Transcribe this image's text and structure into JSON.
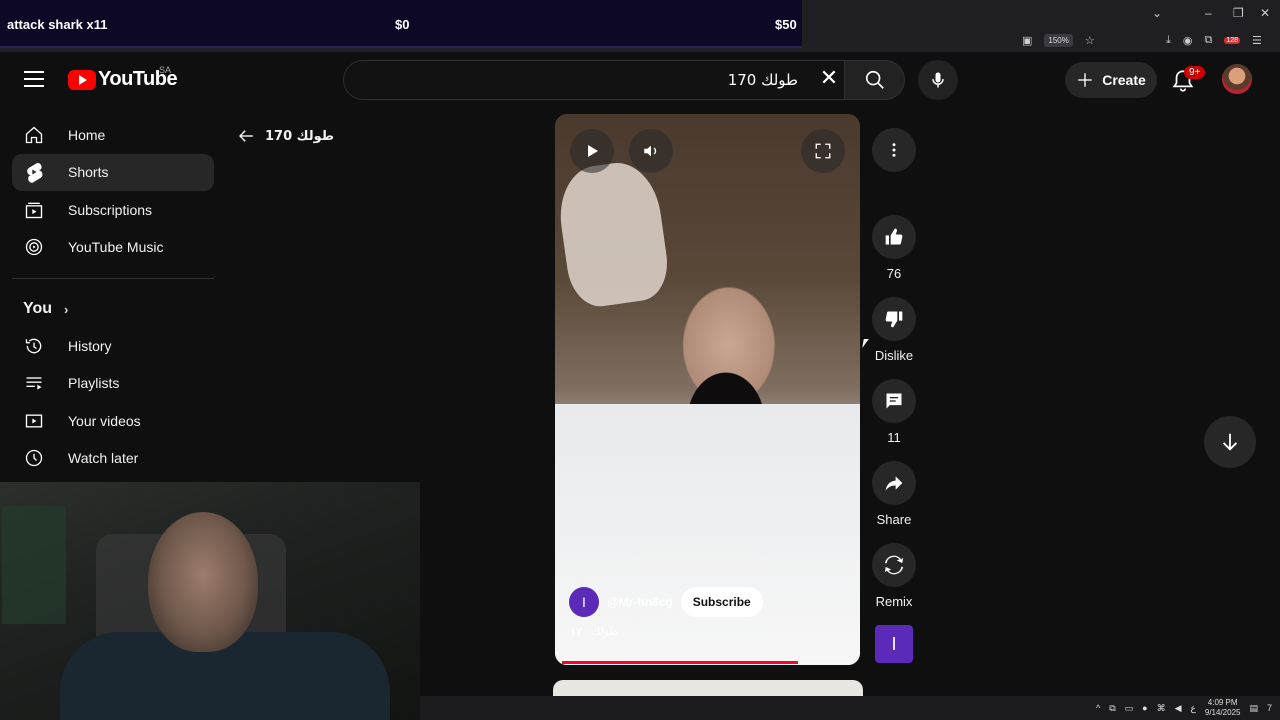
{
  "overlay": {
    "product": "attack shark x11",
    "price_left": "$0",
    "price_right": "$50"
  },
  "browser": {
    "zoom": "150%",
    "ext_badge": "128"
  },
  "header": {
    "logo_text": "YouTube",
    "country": "SA",
    "search_value": "طولك 170",
    "create_label": "Create",
    "notifications": "9+"
  },
  "sidebar": {
    "items": [
      {
        "label": "Home",
        "icon": "home-icon"
      },
      {
        "label": "Shorts",
        "icon": "shorts-icon"
      },
      {
        "label": "Subscriptions",
        "icon": "subscriptions-icon"
      },
      {
        "label": "YouTube Music",
        "icon": "music-icon"
      }
    ],
    "you_label": "You",
    "you_items": [
      {
        "label": "History",
        "icon": "history-icon"
      },
      {
        "label": "Playlists",
        "icon": "playlists-icon"
      },
      {
        "label": "Your videos",
        "icon": "your-videos-icon"
      },
      {
        "label": "Watch later",
        "icon": "watch-later-icon"
      }
    ]
  },
  "page": {
    "back_title": "طولك 170"
  },
  "short": {
    "channel_initial": "I",
    "channel_handle": "@Mr-hn6cg",
    "subscribe_label": "Subscribe",
    "title": "طولك ١٧٠",
    "progress": 0.81
  },
  "actions": {
    "likes": "76",
    "dislike_label": "Dislike",
    "comments": "11",
    "share_label": "Share",
    "remix_label": "Remix",
    "sound_initial": "I"
  },
  "taskbar": {
    "time": "4:09 PM",
    "date": "9/14/2025",
    "notif_count": "7",
    "lang": "ع"
  },
  "colors": {
    "accent_red": "#ff0000",
    "progress": "#ff0033",
    "channel_purple": "#5b2ab8"
  }
}
